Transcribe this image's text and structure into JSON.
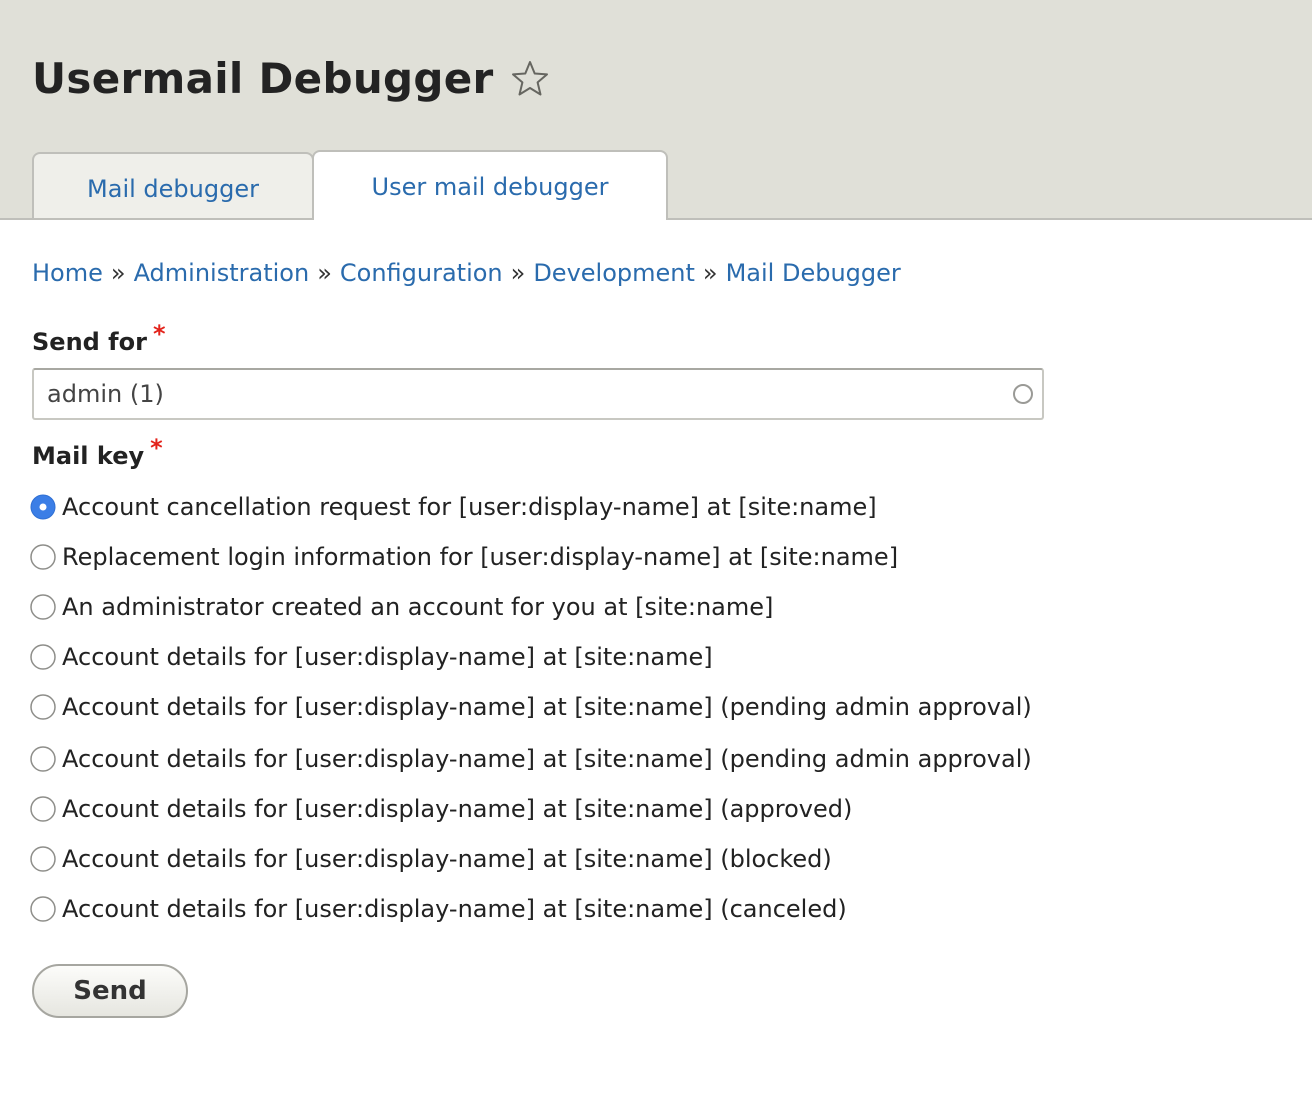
{
  "page": {
    "title": "Usermail Debugger",
    "favorite_icon": "star-outline-icon"
  },
  "tabs": [
    {
      "label": "Mail debugger",
      "active": false
    },
    {
      "label": "User mail debugger",
      "active": true
    }
  ],
  "breadcrumb": {
    "separator": "»",
    "items": [
      "Home",
      "Administration",
      "Configuration",
      "Development",
      "Mail Debugger"
    ]
  },
  "form": {
    "send_for": {
      "label": "Send for",
      "required_marker": "*",
      "value": "admin (1)",
      "autocomplete_icon": "throbber-icon"
    },
    "mail_key": {
      "label": "Mail key",
      "required_marker": "*",
      "selected_index": 0,
      "options": [
        "Account cancellation request for [user:display-name] at [site:name]",
        "Replacement login information for [user:display-name] at [site:name]",
        "An administrator created an account for you at [site:name]",
        "Account details for [user:display-name] at [site:name]",
        "Account details for [user:display-name] at [site:name] (pending admin approval)",
        "Account details for [user:display-name] at [site:name] (pending admin approval)",
        "Account details for [user:display-name] at [site:name] (approved)",
        "Account details for [user:display-name] at [site:name] (blocked)",
        "Account details for [user:display-name] at [site:name] (canceled)"
      ]
    },
    "submit_label": "Send"
  },
  "colors": {
    "header_bg": "#e0e0d8",
    "link": "#2a6bad",
    "required": "#e3231b",
    "radio_selected": "#3b7ee6"
  }
}
